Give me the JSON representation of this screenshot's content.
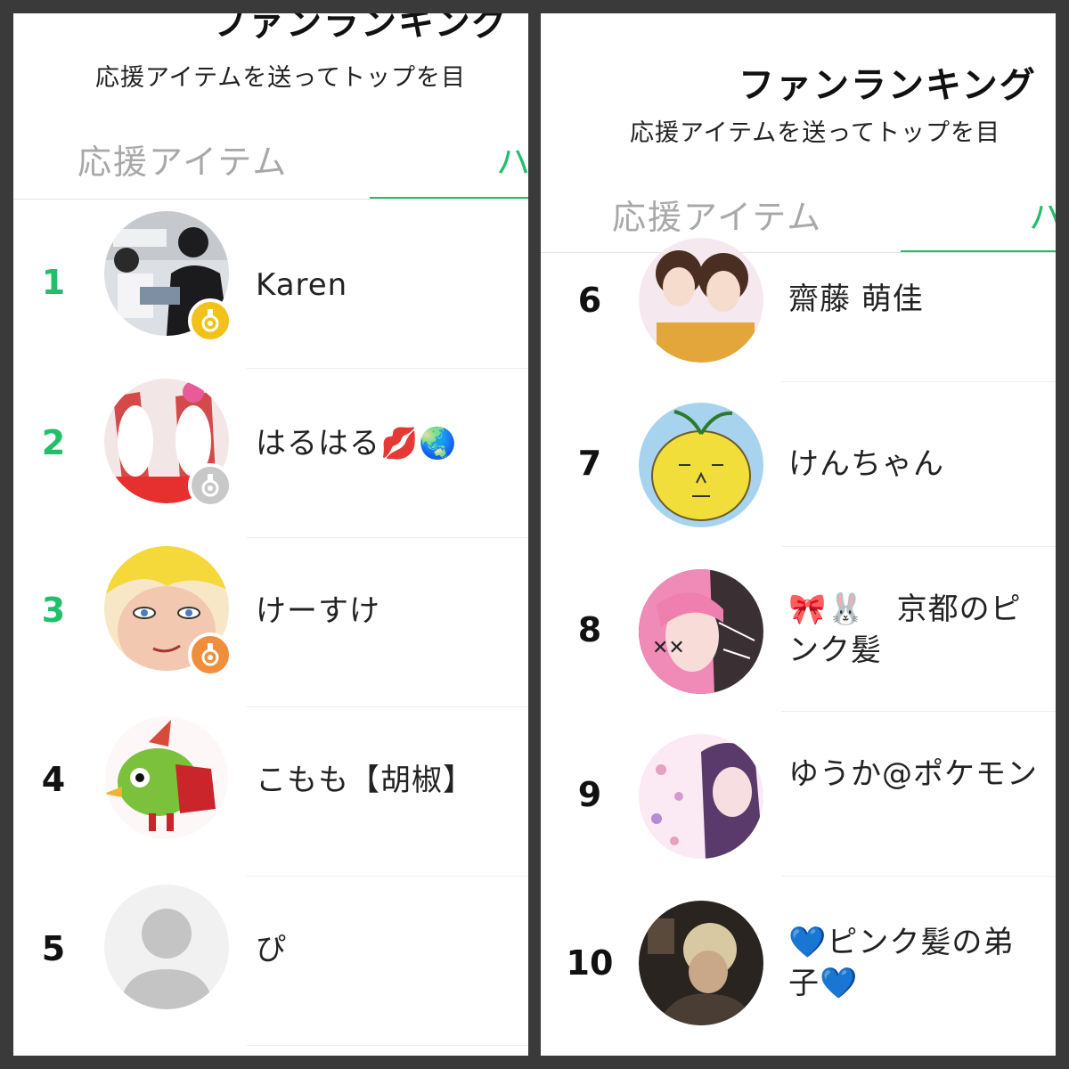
{
  "colors": {
    "accent": "#22bf6a",
    "gold": "#f2c21b",
    "silver": "#c8c8c8",
    "bronze": "#f08f3b",
    "frame": "#3a3a3a"
  },
  "left_panel": {
    "title": "ファンランキング",
    "subtitle": "応援アイテムを送ってトップを目",
    "tabs": [
      {
        "label": "応援アイテム",
        "active": false
      },
      {
        "label": "ハ",
        "active": true
      }
    ],
    "ranking": [
      {
        "rank": "1",
        "name": "Karen",
        "medal": "gold-medal-icon"
      },
      {
        "rank": "2",
        "name": "はるはる💋🌏",
        "medal": "silver-medal-icon"
      },
      {
        "rank": "3",
        "name": "けーすけ",
        "medal": "bronze-medal-icon"
      },
      {
        "rank": "4",
        "name": "こもも【胡椒】"
      },
      {
        "rank": "5",
        "name": "ぴ"
      }
    ]
  },
  "right_panel": {
    "title": "ファンランキング",
    "subtitle": "応援アイテムを送ってトップを目",
    "tabs": [
      {
        "label": "応援アイテム",
        "active": false
      },
      {
        "label": "ハ",
        "active": true
      }
    ],
    "ranking": [
      {
        "rank": "6",
        "name": "齋藤 萌佳"
      },
      {
        "rank": "7",
        "name": "けんちゃん"
      },
      {
        "rank": "8",
        "name": "🎀🐰　京都のピンク髪"
      },
      {
        "rank": "9",
        "name": "ゆうか@ポケモン"
      },
      {
        "rank": "10",
        "name": "💙ピンク髪の弟子💙"
      }
    ]
  }
}
